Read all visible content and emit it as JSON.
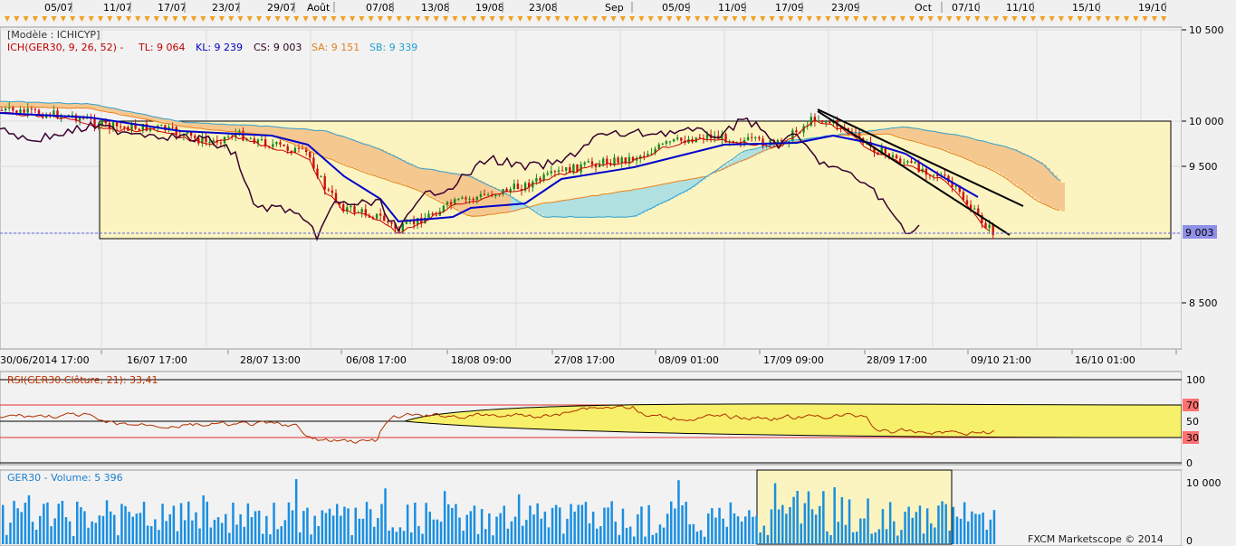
{
  "top_dates": [
    "05/07",
    "11/07",
    "17/07",
    "23/07",
    "29/07",
    "Août",
    "07/08",
    "13/08",
    "19/08",
    "23/08",
    "Sep",
    "05/09",
    "11/09",
    "17/09",
    "23/09",
    "Oct",
    "07/10",
    "11/10",
    "15/10",
    "19/10"
  ],
  "bottom_dates": [
    "30/06/2014 17:00",
    "16/07 17:00",
    "28/07 13:00",
    "06/08 17:00",
    "18/08 09:00",
    "27/08 17:00",
    "08/09 01:00",
    "17/09 09:00",
    "28/09 17:00",
    "09/10 21:00",
    "16/10 01:00"
  ],
  "main_panel": {
    "model_label": "[Modèle : ICHICYP]",
    "indicator_name": "ICH(GER30, 9, 26, 52) -",
    "tl_label": "TL: 9 064",
    "kl_label": "KL: 9 239",
    "cs_label": "CS: 9 003",
    "sa_label": "SA: 9 151",
    "sb_label": "SB: 9 339",
    "y_ticks": [
      "10 500",
      "10 000",
      "9 500",
      "9 000",
      "8 500"
    ],
    "current_price": "9 003",
    "colors": {
      "tenkan": "#cc0000",
      "kijun": "#0000cc",
      "chikou": "#3a0030",
      "span_a": "#e88020",
      "span_b": "#30a0d0",
      "cloud_up": "#f5c890",
      "cloud_down": "#b0e0e0",
      "box_fill": "#fbf4c0",
      "price_tag": "#9090e8"
    }
  },
  "rsi_panel": {
    "label": "RSI(GER30.Clôture, 21): 33,41",
    "levels": [
      "100",
      "70",
      "50",
      "30",
      "0"
    ],
    "colors": {
      "line": "#b03000",
      "overbought": "#ff6060",
      "fill": "#f6f06a"
    }
  },
  "volume_panel": {
    "label": "GER30 - Volume: 5 396",
    "y_ticks": [
      "10 000",
      "0"
    ],
    "colors": {
      "bar": "#1a8fe0",
      "box_fill": "#fbf4c0"
    }
  },
  "footer": "FXCM Marketscope © 2014"
}
